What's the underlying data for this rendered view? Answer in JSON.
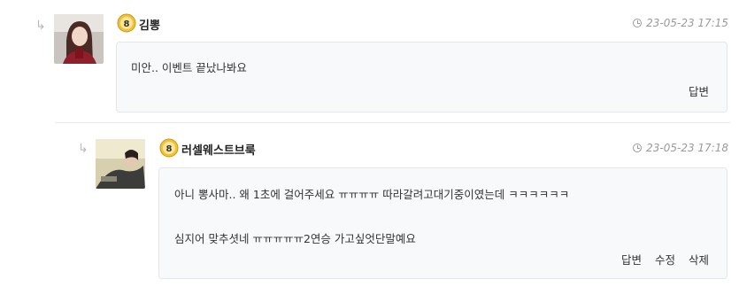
{
  "comments": [
    {
      "author": "김뽕",
      "level": "8",
      "timestamp": "23-05-23 17:15",
      "lines": [
        "미안.. 이벤트 끝났나봐요"
      ],
      "actions": [
        "답변"
      ]
    },
    {
      "author": "러셀웨스트브룩",
      "level": "8",
      "timestamp": "23-05-23 17:18",
      "lines": [
        "아니 뽕사마.. 왜 1초에 걸어주세요 ㅠㅠㅠㅠ 따라갈려고대기중이였는데 ㅋㅋㅋㅋㅋㅋ",
        "심지어 맞추셧네 ㅠㅠㅠㅠㅠ2연승 가고싶엇단말예요"
      ],
      "actions": [
        "답변",
        "수정",
        "삭제"
      ]
    }
  ],
  "icons": {
    "reply": "reply-arrow-icon",
    "clock": "clock-icon",
    "level": "level-badge-icon"
  }
}
